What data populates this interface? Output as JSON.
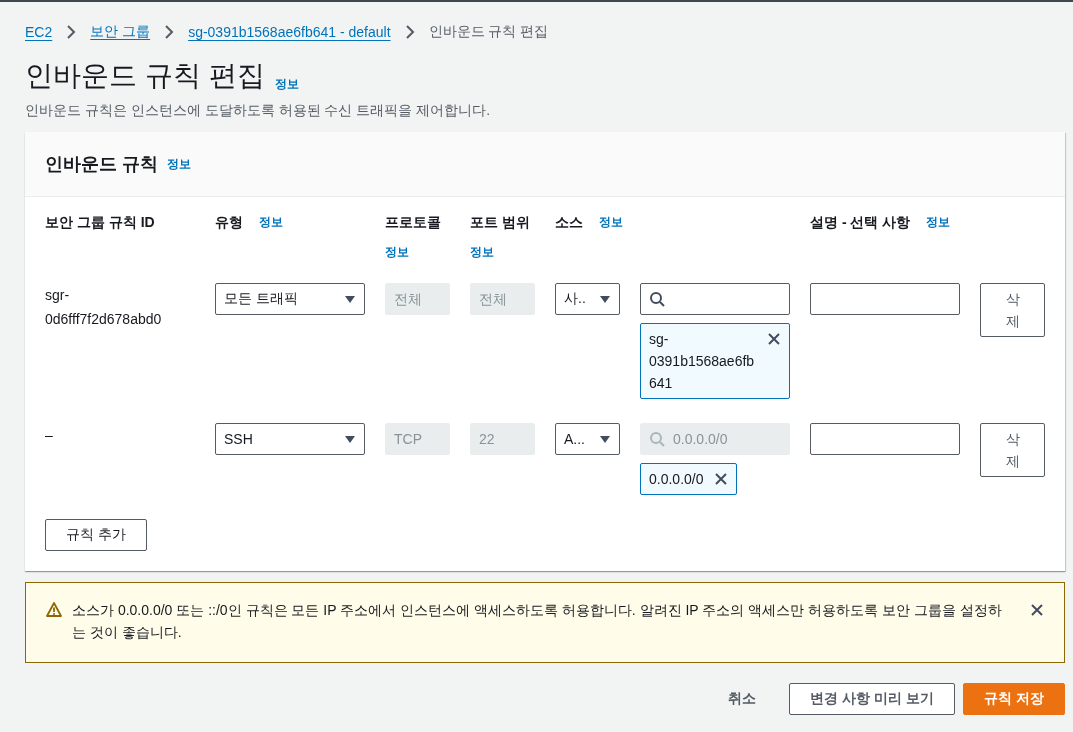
{
  "breadcrumbs": [
    {
      "label": "EC2",
      "link": true
    },
    {
      "label": "보안 그룹",
      "link": true
    },
    {
      "label": "sg-0391b1568ae6fb641 - default",
      "link": true
    },
    {
      "label": "인바운드 규칙 편집",
      "link": false
    }
  ],
  "page": {
    "title": "인바운드 규칙 편집",
    "info": "정보",
    "description": "인바운드 규칙은 인스턴스에 도달하도록 허용된 수신 트래픽을 제어합니다."
  },
  "panel": {
    "title": "인바운드 규칙",
    "info": "정보"
  },
  "columns": [
    {
      "label": "보안 그룹 규칙 ID",
      "kind": "inline"
    },
    {
      "label": "유형",
      "info": "정보",
      "kind": "inline"
    },
    {
      "label": "프로토콜",
      "info": "정보",
      "kind": "stacked"
    },
    {
      "label": "포트 범위",
      "info": "정보",
      "kind": "stacked"
    },
    {
      "label": "소스",
      "info": "정보",
      "kind": "inline"
    },
    {
      "label": "설명 - 선택 사항",
      "info": "정보",
      "kind": "inline"
    }
  ],
  "rules": [
    {
      "id": "sgr-0d6fff7f2d678abd0",
      "type": "모든 트래픽",
      "protocol": {
        "value": "전체",
        "disabled": true
      },
      "port": {
        "value": "전체",
        "disabled": true
      },
      "source_type": "사..",
      "source_search": {
        "disabled": false
      },
      "tokens": [
        "sg-0391b1568ae6fb641"
      ],
      "delete": "삭제"
    },
    {
      "id": "–",
      "type": "SSH",
      "protocol": {
        "value": "TCP",
        "disabled": true
      },
      "port": {
        "value": "22",
        "disabled": true
      },
      "source_type": "A...",
      "source_search": {
        "placeholder": "0.0.0.0/0",
        "disabled": true
      },
      "tokens": [
        "0.0.0.0/0"
      ],
      "delete": "삭제"
    }
  ],
  "add_button": "규칙 추가",
  "warning": {
    "text": "소스가 0.0.0.0/0 또는 ::/0인 규칙은 모든 IP 주소에서 인스턴스에 액세스하도록 허용합니다. 알려진 IP 주소의 액세스만 허용하도록 보안 그룹을 설정하는 것이 좋습니다."
  },
  "footer": [
    {
      "label": "취소",
      "kind": "link"
    },
    {
      "label": "변경 사항 미리 보기",
      "kind": "normal"
    },
    {
      "label": "규칙 저장",
      "kind": "primary"
    }
  ]
}
